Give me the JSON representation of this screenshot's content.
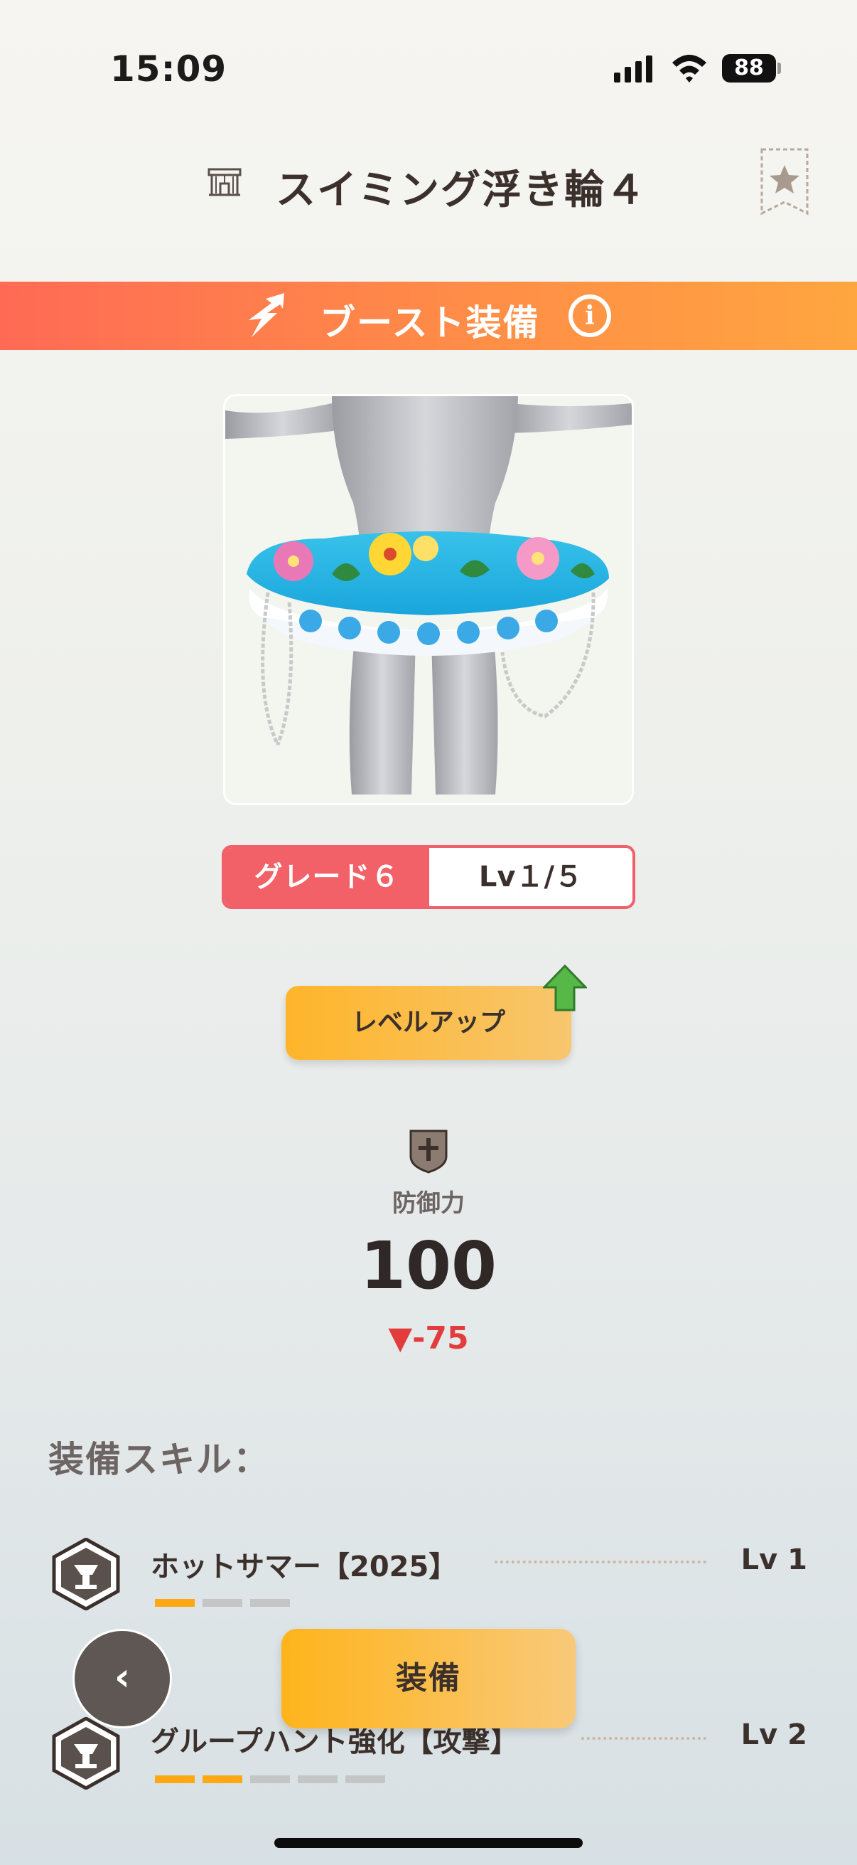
{
  "status_bar": {
    "time": "15:09",
    "battery": "88"
  },
  "header": {
    "title": "スイミング浮き輪４",
    "item_icon": "armor-icon",
    "favorite_icon": "star-icon"
  },
  "boost": {
    "label": "ブースト装備",
    "icon": "boost-arrow-icon",
    "info_icon": "info-icon"
  },
  "item": {
    "image": "swim-ring-on-mannequin"
  },
  "grade": {
    "grade_label": "グレード６",
    "level_label": "Lv１/５"
  },
  "level_up": {
    "label": "レベルアップ",
    "upgrade_icon": "green-up-arrow-icon"
  },
  "stat": {
    "icon": "shield-icon",
    "label": "防御力",
    "value": "100",
    "change": "▼-75"
  },
  "skills": {
    "title": "装備スキル：",
    "items": [
      {
        "name": "ホットサマー【2025】",
        "level": "Lv 1",
        "pips_filled": 1,
        "pips_total": 3
      },
      {
        "name": "グループハント強化【攻撃】",
        "level": "Lv 2",
        "pips_filled": 2,
        "pips_total": 5
      }
    ]
  },
  "actions": {
    "back": "‹",
    "equip": "装備"
  },
  "colors": {
    "accent_orange": "#ffb41c",
    "boost_start": "#ff6a55",
    "boost_end": "#ffa640",
    "grade_red": "#f26168",
    "decrease_red": "#e23c3c"
  }
}
